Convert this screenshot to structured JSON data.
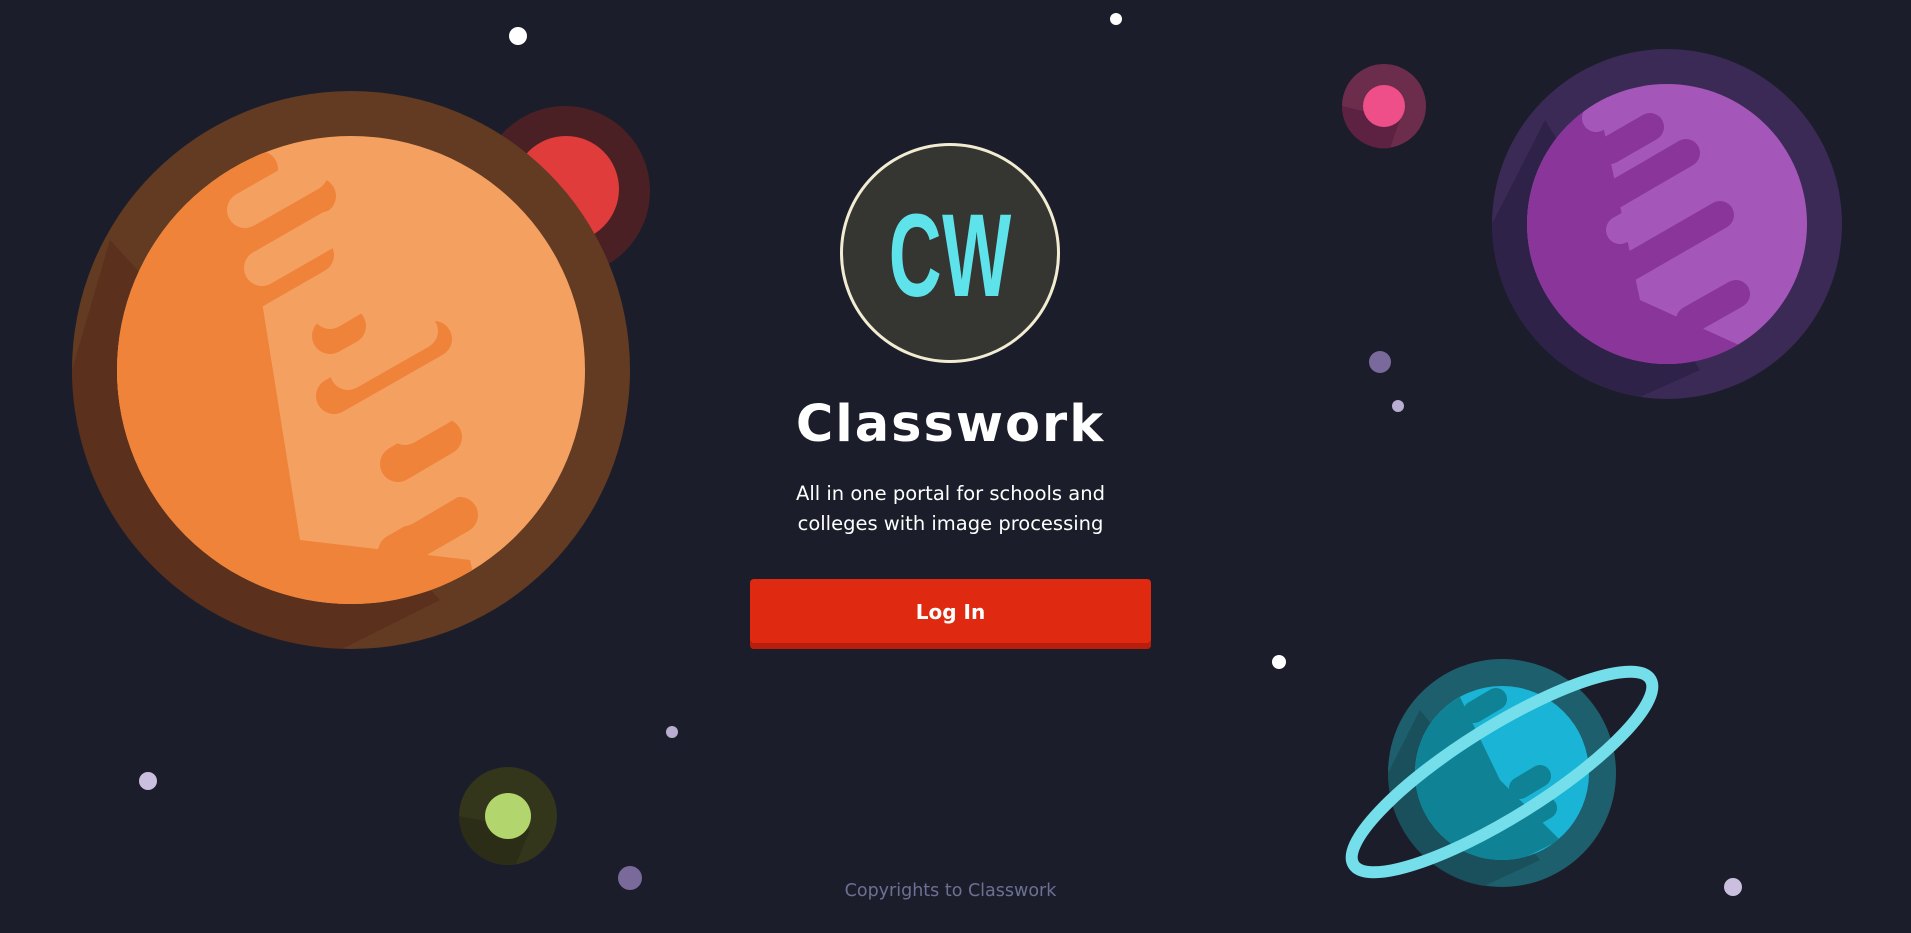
{
  "logo": {
    "text": "CW",
    "icon": "cw-logo-icon",
    "color": "#5ee3ea"
  },
  "app": {
    "title": "Classwork",
    "tagline_line1": "All in one portal for schools and",
    "tagline_line2": "colleges with image processing"
  },
  "actions": {
    "login_label": "Log In",
    "accent": "#df2910"
  },
  "footer": {
    "copyright": "Copyrights to Classwork"
  },
  "theme": {
    "background": "#1b1e2a",
    "planet_orange": "#f4a061",
    "planet_purple": "#a457b8",
    "planet_cyan": "#1ab4d6",
    "ring_cyan": "#74dfea"
  }
}
